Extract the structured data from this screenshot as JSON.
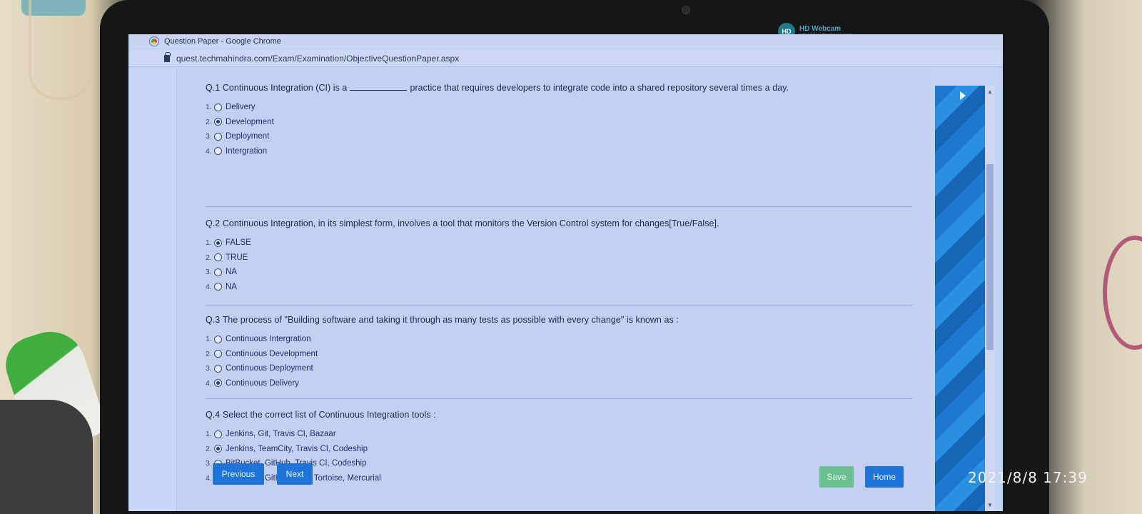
{
  "webcam": {
    "title": "HD Webcam",
    "subtitle": "HD Video Conferencing",
    "logo": "HD"
  },
  "browser": {
    "window_title": "Question Paper - Google Chrome",
    "url": "quest.techmahindra.com/Exam/Examination/ObjectiveQuestionPaper.aspx",
    "controls": {
      "minimize": "–",
      "restore": "▫",
      "close": "✕"
    }
  },
  "questions": [
    {
      "text_before": "Q.1 Continuous Integration (CI) is a",
      "text_after": "practice that requires developers to integrate code into a shared repository several times a day.",
      "options": [
        {
          "num": "1.",
          "label": "Delivery",
          "selected": false
        },
        {
          "num": "2.",
          "label": "Development",
          "selected": true
        },
        {
          "num": "3.",
          "label": "Deployment",
          "selected": false
        },
        {
          "num": "4.",
          "label": "Intergration",
          "selected": false
        }
      ]
    },
    {
      "text": "Q.2 Continuous Integration, in its simplest form, involves a tool that monitors the Version Control system for changes[True/False].",
      "options": [
        {
          "num": "1.",
          "label": "FALSE",
          "selected": true
        },
        {
          "num": "2.",
          "label": "TRUE",
          "selected": false
        },
        {
          "num": "3.",
          "label": "NA",
          "selected": false
        },
        {
          "num": "4.",
          "label": "NA",
          "selected": false
        }
      ]
    },
    {
      "text": "Q.3 The process of \"Building software and taking it through as many tests as possible with every change\" is known as :",
      "options": [
        {
          "num": "1.",
          "label": "Continuous Intergration",
          "selected": false
        },
        {
          "num": "2.",
          "label": "Continuous Development",
          "selected": false
        },
        {
          "num": "3.",
          "label": "Continuous Deployment",
          "selected": false
        },
        {
          "num": "4.",
          "label": "Continuous Delivery",
          "selected": true
        }
      ]
    },
    {
      "text": "Q.4 Select the correct list of Continuous Integration tools :",
      "options": [
        {
          "num": "1.",
          "label": "Jenkins, Git, Travis CI, Bazaar",
          "selected": false
        },
        {
          "num": "2.",
          "label": "Jenkins, TeamCity, Travis CI, Codeship",
          "selected": true
        },
        {
          "num": "3.",
          "label": "BitBucket, GitHub, Travis CI, Codeship",
          "selected": false
        },
        {
          "num": "4.",
          "label": "BitBucket, GitHub, SVN Tortoise, Mercurial",
          "selected": false
        }
      ]
    }
  ],
  "buttons": {
    "previous": "Previous",
    "next": "Next",
    "save": "Save",
    "home": "Home"
  },
  "timestamp": "2021/8/8 17:39"
}
